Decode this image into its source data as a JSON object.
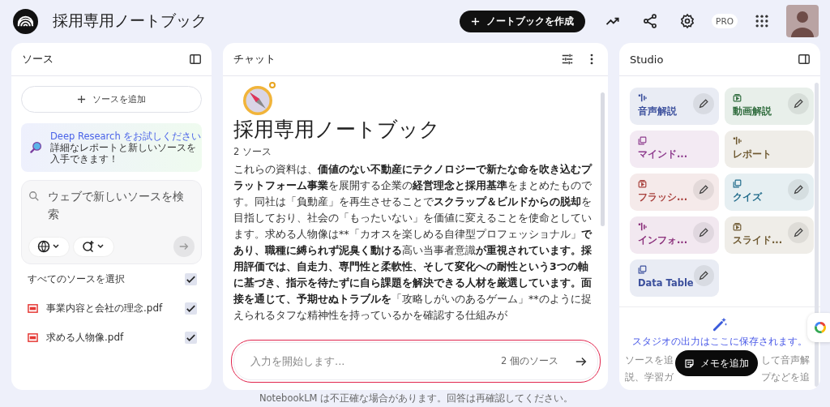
{
  "header": {
    "title": "採用専用ノートブック",
    "create_button": "ノートブックを作成",
    "plan_badge": "PRO"
  },
  "sources": {
    "title": "ソース",
    "add_button": "ソースを追加",
    "promo": {
      "link": "Deep Research をお試しください",
      "text": "詳細なレポートと新しいソースを入手できます！"
    },
    "search": {
      "placeholder": "ウェブで新しいソースを検索"
    },
    "select_all": {
      "label": "すべてのソースを選択",
      "checked": true
    },
    "items": [
      {
        "name": "事業内容と会社の理念.pdf",
        "checked": true
      },
      {
        "name": "求める人物像.pdf",
        "checked": true
      }
    ]
  },
  "chat": {
    "title": "チャット",
    "notebook_title": "採用専用ノートブック",
    "source_count": "2 ソース",
    "summary": [
      {
        "text": "これらの資料は、",
        "bold": false
      },
      {
        "text": "価値のない不動産にテクノロジーで新たな命を吹き込むプラットフォーム事業",
        "bold": true
      },
      {
        "text": "を展開する企業の",
        "bold": false
      },
      {
        "text": "経営理念と採用基準",
        "bold": true
      },
      {
        "text": "をまとめたものです。同社は「負動産」を再生させることで",
        "bold": false
      },
      {
        "text": "スクラップ＆ビルドからの脱却",
        "bold": true
      },
      {
        "text": "を目指しており、社会の「もったいない」を価値に変えることを使命としています。求める人物像は**「カオスを楽しめる自律型プロフェッショナル」",
        "bold": false
      },
      {
        "text": "であり、職種に縛られず泥臭く動ける",
        "bold": true
      },
      {
        "text": "高い当事者意識",
        "bold": false
      },
      {
        "text": "が重視されています。採用評価では、自走力、専門性と柔軟性、そして変化への耐性という3つの軸に基づき、指示を待たずに自ら課題を解決できる人材を厳選しています。面接を通じて、予期せぬトラブルを",
        "bold": true
      },
      {
        "text": "「攻略しがいのあるゲーム」**のように捉えられるタフな精神性を持っているかを確認する仕組みが",
        "bold": false
      }
    ],
    "input": {
      "placeholder": "入力を開始します...",
      "source_count": "2 個のソース"
    },
    "disclaimer": "NotebookLM は不正確な場合があります。回答は再確認してください。"
  },
  "studio": {
    "title": "Studio",
    "tools": [
      {
        "label": "音声解説",
        "color": "#3b4f9c",
        "editable": true
      },
      {
        "label": "動画解説",
        "color": "#2e6b3c",
        "editable": true
      },
      {
        "label": "マインド...",
        "color": "#8e3c8e",
        "editable": false
      },
      {
        "label": "レポート",
        "color": "#6f5a32",
        "editable": false
      },
      {
        "label": "フラッシ...",
        "color": "#a8403c",
        "editable": true
      },
      {
        "label": "クイズ",
        "color": "#1f6a8a",
        "editable": true
      },
      {
        "label": "インフォ...",
        "color": "#8a2e7a",
        "editable": true
      },
      {
        "label": "スライド...",
        "color": "#6f5a32",
        "editable": true
      },
      {
        "label": "Data Table",
        "color": "#3b4f9c",
        "editable": true
      }
    ],
    "empty_title": "スタジオの出力はここに保存されます。",
    "empty_text_lines": [
      [
        "ソースを追",
        "して音声解"
      ],
      [
        "説、学習ガ",
        "プなどを追"
      ]
    ],
    "note_button": "メモを追加"
  }
}
